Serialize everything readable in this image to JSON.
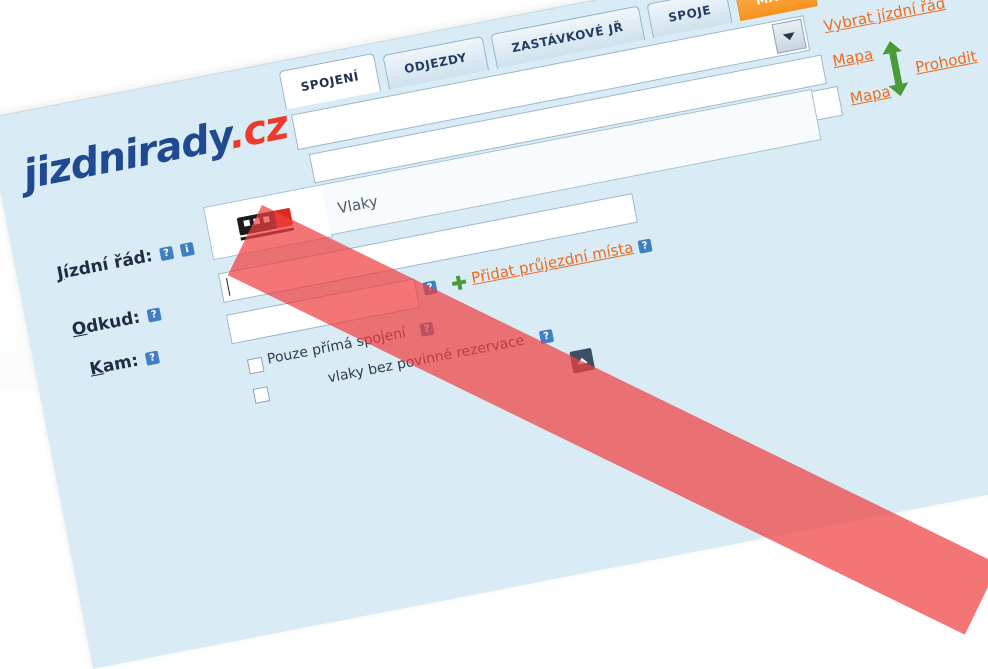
{
  "logo": {
    "main": "jizdnirady",
    "tld": ".cz"
  },
  "tabs": [
    {
      "label": "SPOJENÍ"
    },
    {
      "label": "ODJEZDY"
    },
    {
      "label": "ZASTÁVKOVÉ JŘ"
    },
    {
      "label": "SPOJE"
    },
    {
      "label": "MAPA"
    }
  ],
  "links": {
    "select_timetable": "Vybrat jízdní řád",
    "map_from": "Mapa",
    "map_to": "Mapa",
    "swap": "Prohodit",
    "add_via": "Přidat průjezdní místa"
  },
  "labels": {
    "timetable_prefix": "",
    "timetable_underline": "J",
    "timetable_rest": "ízdní řád:",
    "from_underline": "O",
    "from_rest": "dkud:",
    "to_underline": "K",
    "to_rest": "am:"
  },
  "timetable": {
    "value": "Vlaky"
  },
  "help": {
    "q": "?",
    "i": "i"
  },
  "options": {
    "direct_only": "Pouze přímá spojení",
    "no_reservation": "vlaky bez povinné rezervace"
  },
  "colors": {
    "brand_blue": "#1f4a8f",
    "brand_red": "#ee3a2a",
    "accent_orange": "#f6921e",
    "panel_bg": "#d9ecf6",
    "overlay_red": "#ef4040"
  }
}
